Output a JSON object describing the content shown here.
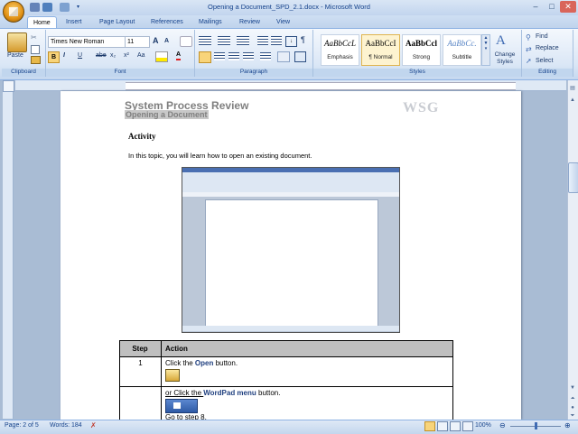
{
  "window": {
    "title": "Opening a Document_SPD_2.1.docx - Microsoft Word",
    "controls": {
      "minimize": "–",
      "maximize": "□",
      "close": "✕"
    }
  },
  "tabs": [
    "Home",
    "Insert",
    "Page Layout",
    "References",
    "Mailings",
    "Review",
    "View"
  ],
  "ribbon": {
    "clipboard": {
      "label": "Clipboard",
      "paste": "Paste"
    },
    "font": {
      "label": "Font",
      "name": "Times New Roman",
      "size": "11",
      "grow": "A",
      "shrink": "A",
      "bold": "B",
      "italic": "I",
      "underline": "U",
      "strike": "abe",
      "sub": "x₂",
      "sup": "x²",
      "case": "Aa",
      "color": "A"
    },
    "paragraph": {
      "label": "Paragraph",
      "pilcrow": "¶"
    },
    "styles": {
      "label": "Styles",
      "cards": [
        {
          "sample": "AaBbCcL",
          "name": "Emphasis"
        },
        {
          "sample": "AaBbCcI",
          "name": "¶ Normal"
        },
        {
          "sample": "AaBbCcl",
          "name": "Strong"
        },
        {
          "sample": "AaBbCc.",
          "name": "Subtitle"
        }
      ],
      "change": "Change Styles"
    },
    "editing": {
      "label": "Editing",
      "find": "Find",
      "replace": "Replace",
      "select": "Select"
    }
  },
  "document": {
    "title": "System Process Review",
    "subtitle": "Opening a Document",
    "logo": "WSG",
    "heading": "Activity",
    "intro": "In this topic, you will learn how to open an existing document.",
    "table": {
      "headers": [
        "Step",
        "Action"
      ],
      "rows": [
        {
          "step": "1",
          "pre": "Click the ",
          "kw": "Open",
          "post": " button."
        },
        {
          "step": "",
          "pre": "or Click the ",
          "kw": "WordPad menu",
          "post": " button.",
          "extra": "Go to step 8."
        }
      ]
    }
  },
  "status": {
    "page": "Page: 2 of 5",
    "words": "Words: 184",
    "zoom": "100%"
  }
}
